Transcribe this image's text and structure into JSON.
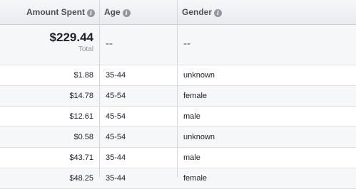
{
  "header": {
    "amount_spent": "Amount Spent",
    "age": "Age",
    "gender": "Gender",
    "info_icon": "info-icon"
  },
  "total": {
    "amount": "$229.44",
    "label": "Total",
    "age": "--",
    "gender": "--"
  },
  "rows": [
    {
      "amount": "$1.88",
      "age": "35-44",
      "gender": "unknown"
    },
    {
      "amount": "$14.78",
      "age": "45-54",
      "gender": "female"
    },
    {
      "amount": "$12.61",
      "age": "45-54",
      "gender": "male"
    },
    {
      "amount": "$0.58",
      "age": "45-54",
      "gender": "unknown"
    },
    {
      "amount": "$43.71",
      "age": "35-44",
      "gender": "male"
    },
    {
      "amount": "$48.25",
      "age": "35-44",
      "gender": "female"
    }
  ]
}
